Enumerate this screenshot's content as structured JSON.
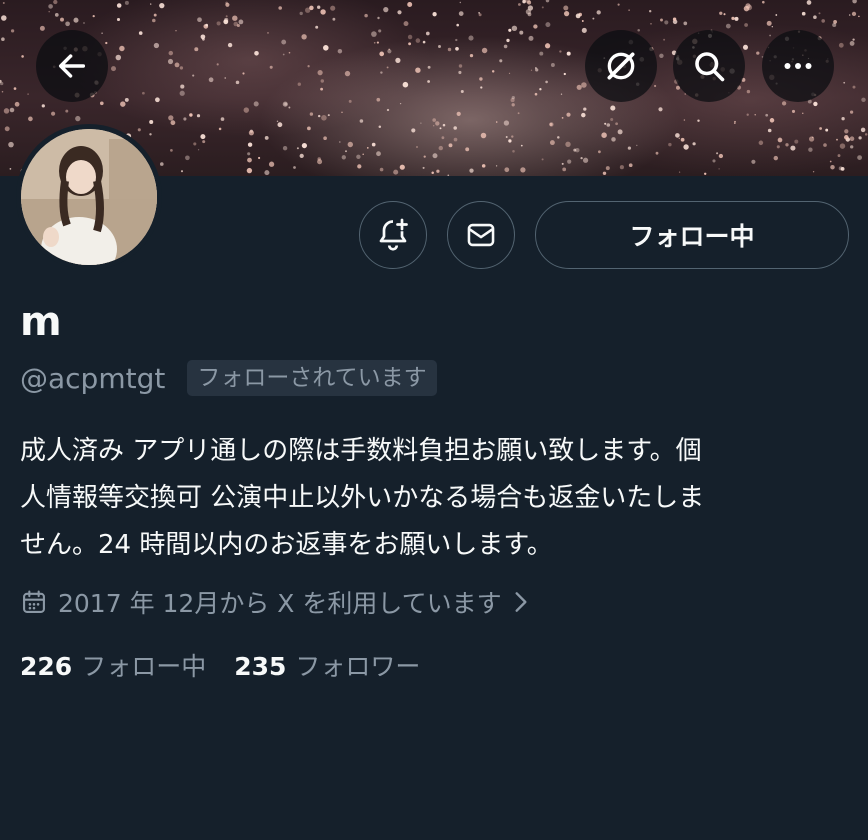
{
  "header": {
    "back_icon": "arrow-left-icon",
    "grok_icon": "grok-icon",
    "search_icon": "search-icon",
    "more_icon": "more-horizontal-icon"
  },
  "profile": {
    "display_name": "m",
    "handle": "@acpmtgt",
    "follows_you_badge": "フォローされています",
    "bio": "成人済み アプリ通しの際は手数料負担お願い致します。個\n人情報等交換可 公演中止以外いかなる場合も返金いたしま\nせん。24 時間以内のお返事をお願いします。",
    "joined": "2017 年 12月から X を利用しています",
    "following_count": "226",
    "following_label": "フォロー中",
    "followers_count": "235",
    "followers_label": "フォロワー"
  },
  "actions": {
    "notify_icon": "bell-plus-icon",
    "dm_icon": "mail-icon",
    "following_button_label": "フォロー中"
  },
  "colors": {
    "background": "#15202b",
    "text_primary": "#f7f9f9",
    "text_secondary": "#8b98a5",
    "border": "#536471",
    "badge_bg": "#273340"
  }
}
